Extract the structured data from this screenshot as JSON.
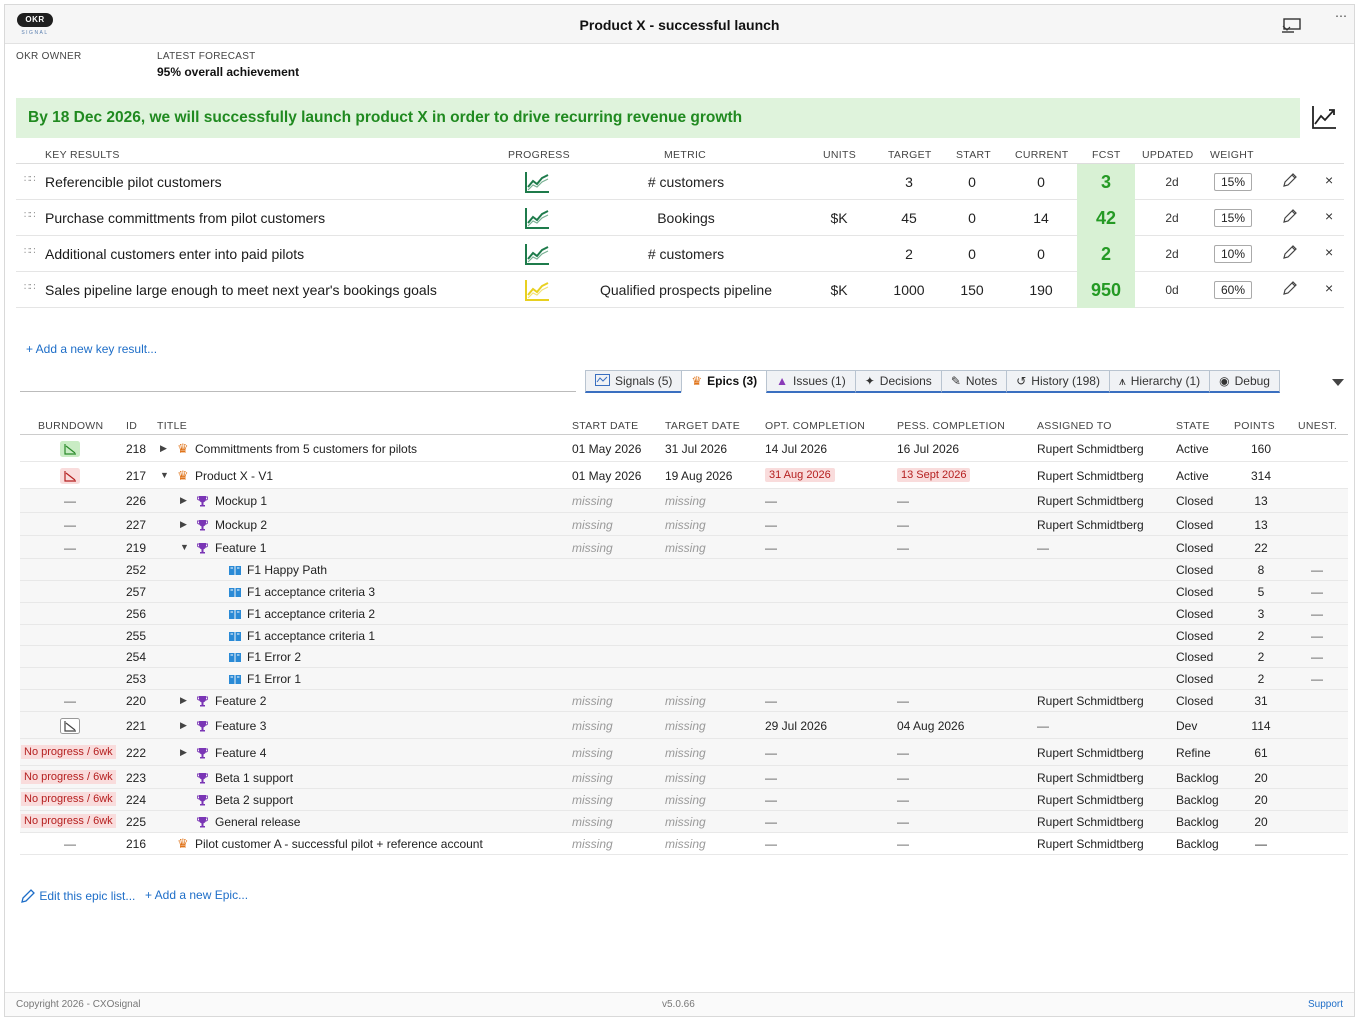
{
  "header": {
    "logo_text": "OKR",
    "logo_sub": "SIGNAL",
    "title": "Product X - successful launch",
    "more": "⋯"
  },
  "meta": {
    "owner_label": "OKR OWNER",
    "forecast_label": "LATEST FORECAST",
    "forecast_value": "95% overall achievement"
  },
  "objective": "By 18 Dec 2026, we will successfully launch product X in order to drive recurring revenue growth",
  "kr_headers": {
    "key_results": "KEY RESULTS",
    "progress": "PROGRESS",
    "metric": "METRIC",
    "units": "UNITS",
    "target": "TARGET",
    "start": "START",
    "current": "CURRENT",
    "fcst": "FCST",
    "updated": "UPDATED",
    "weight": "WEIGHT"
  },
  "key_results": [
    {
      "title": "Referencible pilot customers",
      "progress_color": "#1e7b4b",
      "metric": "# customers",
      "units": "",
      "target": "3",
      "start": "0",
      "current": "0",
      "fcst": "3",
      "updated": "2d",
      "weight": "15%"
    },
    {
      "title": "Purchase committments from pilot customers",
      "progress_color": "#1e7b4b",
      "metric": "Bookings",
      "units": "$K",
      "target": "45",
      "start": "0",
      "current": "14",
      "fcst": "42",
      "updated": "2d",
      "weight": "15%"
    },
    {
      "title": "Additional customers enter into paid pilots",
      "progress_color": "#1e7b4b",
      "metric": "# customers",
      "units": "",
      "target": "2",
      "start": "0",
      "current": "0",
      "fcst": "2",
      "updated": "2d",
      "weight": "10%"
    },
    {
      "title": "Sales pipeline large enough to meet next year's bookings goals",
      "progress_color": "#e8d020",
      "metric": "Qualified prospects pipeline",
      "units": "$K",
      "target": "1000",
      "start": "150",
      "current": "190",
      "fcst": "950",
      "updated": "0d",
      "weight": "60%"
    }
  ],
  "add_kr": "+ Add a new key result...",
  "tabs": [
    {
      "label": "Signals (5)",
      "icon": "signals-icon"
    },
    {
      "label": "Epics (3)",
      "icon": "crown-icon"
    },
    {
      "label": "Issues (1)",
      "icon": "cone-icon"
    },
    {
      "label": "Decisions",
      "icon": "decision-icon"
    },
    {
      "label": "Notes",
      "icon": "notes-icon"
    },
    {
      "label": "History (198)",
      "icon": "history-icon"
    },
    {
      "label": "Hierarchy (1)",
      "icon": "hierarchy-icon"
    },
    {
      "label": "Debug",
      "icon": "debug-icon"
    }
  ],
  "epic_headers": {
    "burndown": "BURNDOWN",
    "id": "ID",
    "title": "TITLE",
    "start_date": "START DATE",
    "target_date": "TARGET DATE",
    "opt": "OPT. COMPLETION",
    "pess": "PESS. COMPLETION",
    "assigned": "ASSIGNED TO",
    "state": "STATE",
    "points": "POINTS",
    "unest": "UNEST."
  },
  "epics": [
    {
      "burndown": "green-chart",
      "id": "218",
      "level": 0,
      "expander": "▶",
      "icon": "crown",
      "title": "Committments from 5 customers for pilots",
      "start": "01 May 2026",
      "target": "31 Jul 2026",
      "opt": "14 Jul 2026",
      "pess": "16 Jul 2026",
      "assigned": "Rupert Schmidtberg",
      "state": "Active",
      "points": "160",
      "unest": ""
    },
    {
      "burndown": "red-chart",
      "id": "217",
      "level": 0,
      "expander": "▼",
      "icon": "crown",
      "title": "Product X - V1",
      "start": "01 May 2026",
      "target": "19 Aug 2026",
      "opt": "31 Aug 2026",
      "pess": "13 Sept 2026",
      "assigned": "Rupert Schmidtberg",
      "state": "Active",
      "points": "314",
      "unest": ""
    },
    {
      "burndown": "—",
      "id": "226",
      "level": 1,
      "expander": "▶",
      "icon": "trophy",
      "title": "Mockup 1",
      "start": "missing",
      "target": "missing",
      "opt": "—",
      "pess": "—",
      "assigned": "Rupert Schmidtberg",
      "state": "Closed",
      "points": "13",
      "unest": ""
    },
    {
      "burndown": "—",
      "id": "227",
      "level": 1,
      "expander": "▶",
      "icon": "trophy",
      "title": "Mockup 2",
      "start": "missing",
      "target": "missing",
      "opt": "—",
      "pess": "—",
      "assigned": "Rupert Schmidtberg",
      "state": "Closed",
      "points": "13",
      "unest": ""
    },
    {
      "burndown": "—",
      "id": "219",
      "level": 1,
      "expander": "▼",
      "icon": "trophy",
      "title": "Feature 1",
      "start": "missing",
      "target": "missing",
      "opt": "—",
      "pess": "—",
      "assigned": "—",
      "state": "Closed",
      "points": "22",
      "unest": ""
    },
    {
      "burndown": "",
      "id": "252",
      "level": 2,
      "expander": "",
      "icon": "story",
      "title": "F1 Happy Path",
      "start": "",
      "target": "",
      "opt": "",
      "pess": "",
      "assigned": "",
      "state": "Closed",
      "points": "8",
      "unest": "—"
    },
    {
      "burndown": "",
      "id": "257",
      "level": 2,
      "expander": "",
      "icon": "story",
      "title": "F1 acceptance criteria 3",
      "start": "",
      "target": "",
      "opt": "",
      "pess": "",
      "assigned": "",
      "state": "Closed",
      "points": "5",
      "unest": "—"
    },
    {
      "burndown": "",
      "id": "256",
      "level": 2,
      "expander": "",
      "icon": "story",
      "title": "F1 acceptance criteria 2",
      "start": "",
      "target": "",
      "opt": "",
      "pess": "",
      "assigned": "",
      "state": "Closed",
      "points": "3",
      "unest": "—"
    },
    {
      "burndown": "",
      "id": "255",
      "level": 2,
      "expander": "",
      "icon": "story",
      "title": "F1 acceptance criteria 1",
      "start": "",
      "target": "",
      "opt": "",
      "pess": "",
      "assigned": "",
      "state": "Closed",
      "points": "2",
      "unest": "—"
    },
    {
      "burndown": "",
      "id": "254",
      "level": 2,
      "expander": "",
      "icon": "story",
      "title": "F1 Error 2",
      "start": "",
      "target": "",
      "opt": "",
      "pess": "",
      "assigned": "",
      "state": "Closed",
      "points": "2",
      "unest": "—"
    },
    {
      "burndown": "",
      "id": "253",
      "level": 2,
      "expander": "",
      "icon": "story",
      "title": "F1 Error 1",
      "start": "",
      "target": "",
      "opt": "",
      "pess": "",
      "assigned": "",
      "state": "Closed",
      "points": "2",
      "unest": "—"
    },
    {
      "burndown": "—",
      "id": "220",
      "level": 1,
      "expander": "▶",
      "icon": "trophy",
      "title": "Feature 2",
      "start": "missing",
      "target": "missing",
      "opt": "—",
      "pess": "—",
      "assigned": "Rupert Schmidtberg",
      "state": "Closed",
      "points": "31",
      "unest": ""
    },
    {
      "burndown": "grey-chart",
      "id": "221",
      "level": 1,
      "expander": "▶",
      "icon": "trophy",
      "title": "Feature 3",
      "start": "missing",
      "target": "missing",
      "opt": "29 Jul 2026",
      "pess": "04 Aug 2026",
      "assigned": "—",
      "state": "Dev",
      "points": "114",
      "unest": ""
    },
    {
      "burndown": "No progress / 6wk",
      "id": "222",
      "level": 1,
      "expander": "▶",
      "icon": "trophy",
      "title": "Feature 4",
      "start": "missing",
      "target": "missing",
      "opt": "—",
      "pess": "—",
      "assigned": "Rupert Schmidtberg",
      "state": "Refine",
      "points": "61",
      "unest": ""
    },
    {
      "burndown": "No progress / 6wk",
      "id": "223",
      "level": 1,
      "expander": "",
      "icon": "trophy",
      "title": "Beta 1 support",
      "start": "missing",
      "target": "missing",
      "opt": "—",
      "pess": "—",
      "assigned": "Rupert Schmidtberg",
      "state": "Backlog",
      "points": "20",
      "unest": ""
    },
    {
      "burndown": "No progress / 6wk",
      "id": "224",
      "level": 1,
      "expander": "",
      "icon": "trophy",
      "title": "Beta 2 support",
      "start": "missing",
      "target": "missing",
      "opt": "—",
      "pess": "—",
      "assigned": "Rupert Schmidtberg",
      "state": "Backlog",
      "points": "20",
      "unest": ""
    },
    {
      "burndown": "No progress / 6wk",
      "id": "225",
      "level": 1,
      "expander": "",
      "icon": "trophy",
      "title": "General release",
      "start": "missing",
      "target": "missing",
      "opt": "—",
      "pess": "—",
      "assigned": "Rupert Schmidtberg",
      "state": "Backlog",
      "points": "20",
      "unest": ""
    },
    {
      "burndown": "—",
      "id": "216",
      "level": 0,
      "expander": "",
      "icon": "crown",
      "title": "Pilot customer A - successful pilot + reference account",
      "start": "missing",
      "target": "missing",
      "opt": "—",
      "pess": "—",
      "assigned": "Rupert Schmidtberg",
      "state": "Backlog",
      "points": "—",
      "unest": ""
    }
  ],
  "bottom": {
    "edit_list": "Edit this epic list...",
    "add_epic": "+ Add a new Epic..."
  },
  "footer": {
    "copyright": "Copyright 2026 - CXOsignal",
    "version": "v5.0.66",
    "support": "Support"
  },
  "colors": {
    "accent_blue": "#1e6ec8",
    "objective_bg": "#dff3dc",
    "objective_text": "#208a20",
    "warning_bg": "#f9dcdc",
    "warning_text": "#b52020"
  }
}
